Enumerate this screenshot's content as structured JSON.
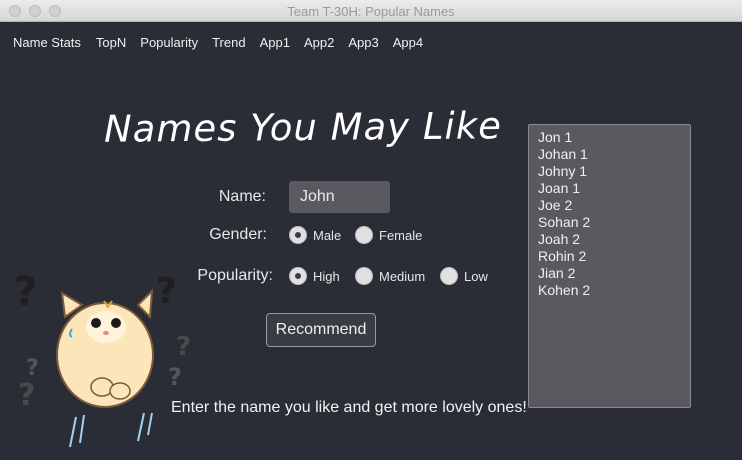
{
  "window": {
    "title": "Team T-30H: Popular Names"
  },
  "menu": [
    "Name Stats",
    "TopN",
    "Popularity",
    "Trend",
    "App1",
    "App2",
    "App3",
    "App4"
  ],
  "hero": {
    "title": "Names You May Like"
  },
  "form": {
    "name_label": "Name:",
    "name_value": "John",
    "gender_label": "Gender:",
    "gender_options": [
      "Male",
      "Female"
    ],
    "gender_selected": "Male",
    "popularity_label": "Popularity:",
    "popularity_options": [
      "High",
      "Medium",
      "Low"
    ],
    "popularity_selected": "High",
    "recommend_label": "Recommend"
  },
  "hint": "Enter the name you like and get more lovely ones!",
  "results": [
    "Jon 1",
    "Johan 1",
    "Johny 1",
    "Joan 1",
    "Joe 2",
    "Sohan 2",
    "Joah 2",
    "Rohin 2",
    "Jian 2",
    "Kohen 2"
  ]
}
